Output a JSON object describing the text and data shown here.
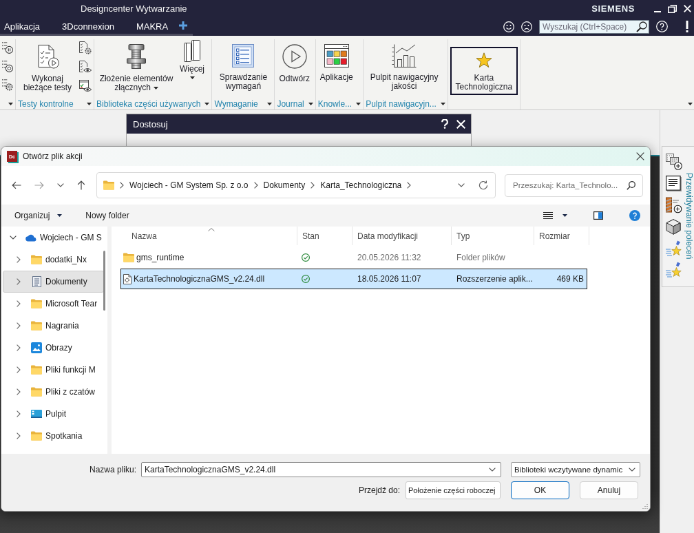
{
  "window": {
    "title": "Designcenter Wytwarzanie",
    "brand": "SIEMENS"
  },
  "menu": {
    "tabs": [
      {
        "label": "Aplikacja"
      },
      {
        "label": "3Dconnexion"
      },
      {
        "label": "MAKRA"
      }
    ],
    "search": {
      "placeholder": "Wyszukaj (Ctrl+Space)"
    }
  },
  "ribbon": {
    "groups": [
      {
        "launcher": true,
        "items": [
          {
            "kind": "small"
          },
          {
            "kind": "small"
          },
          {
            "kind": "small"
          }
        ]
      },
      {
        "label": "Testy kontrolne",
        "launcher": true,
        "items": [
          {
            "kind": "large",
            "label": "Wykonaj bieżące testy",
            "dropdown": false,
            "focused": false
          },
          {
            "kind": "small"
          },
          {
            "kind": "small"
          },
          {
            "kind": "small"
          }
        ]
      },
      {
        "label": "Biblioteka części używanych",
        "launcher": true,
        "items": [
          {
            "kind": "large",
            "label": "Złożenie elementów złącznych",
            "dropdown": true,
            "focused": false
          },
          {
            "kind": "menu",
            "label": "Więcej",
            "dropdown": true
          }
        ]
      },
      {
        "label": "Wymaganie",
        "launcher": true,
        "items": [
          {
            "kind": "large",
            "label": "Sprawdzanie wymagań",
            "dropdown": false,
            "focused": false
          }
        ]
      },
      {
        "label": "Journal",
        "launcher": true,
        "items": [
          {
            "kind": "large",
            "label": "Odtwórz",
            "dropdown": false,
            "focused": false
          }
        ]
      },
      {
        "label": "Knowle...",
        "launcher": true,
        "items": [
          {
            "kind": "large",
            "label": "Aplikacje",
            "dropdown": false,
            "focused": false
          }
        ]
      },
      {
        "label": "Pulpit nawigacyjn...",
        "launcher": true,
        "items": [
          {
            "kind": "large",
            "label": "Pulpit nawigacyjny jakości",
            "dropdown": false,
            "focused": false
          }
        ]
      },
      {
        "items": [
          {
            "kind": "large",
            "label": "Karta Technologiczna",
            "dropdown": false,
            "focused": true
          }
        ]
      }
    ]
  },
  "customize_dialog": {
    "title": "Dostosuj"
  },
  "open_dialog": {
    "title": "Otwórz plik akcji",
    "app_badge": "Dc",
    "path": [
      "Wojciech - GM System Sp. z o.o",
      "Dokumenty",
      "Karta_Technologiczna"
    ],
    "search": {
      "placeholder": "Przeszukaj: Karta_Technolo..."
    },
    "toolbar": {
      "organize": "Organizuj",
      "new_folder": "Nowy folder"
    },
    "nav_tree": [
      {
        "label": "Wojciech - GM S",
        "kind": "cloud",
        "expanded": true,
        "selected": false,
        "children": [
          {
            "label": "dodatki_Nx",
            "kind": "folder",
            "expanded": false,
            "selected": false
          },
          {
            "label": "Dokumenty",
            "kind": "documents",
            "expanded": false,
            "selected": true
          },
          {
            "label": "Microsoft Tear",
            "kind": "folder",
            "expanded": false,
            "selected": false
          },
          {
            "label": "Nagrania",
            "kind": "folder",
            "expanded": false,
            "selected": false
          },
          {
            "label": "Obrazy",
            "kind": "pictures",
            "expanded": false,
            "selected": false
          },
          {
            "label": "Pliki funkcji M",
            "kind": "folder",
            "expanded": false,
            "selected": false
          },
          {
            "label": "Pliki z czatów",
            "kind": "folder",
            "expanded": false,
            "selected": false
          },
          {
            "label": "Pulpit",
            "kind": "desktop",
            "expanded": false,
            "selected": false
          },
          {
            "label": "Spotkania",
            "kind": "folder",
            "expanded": false,
            "selected": false
          }
        ]
      }
    ],
    "columns": [
      {
        "label": "Nazwa",
        "sorted": true
      },
      {
        "label": "Stan",
        "sorted": false
      },
      {
        "label": "Data modyfikacji",
        "sorted": false
      },
      {
        "label": "Typ",
        "sorted": false
      },
      {
        "label": "Rozmiar",
        "sorted": false
      }
    ],
    "rows": [
      {
        "kind": "folder",
        "name": "gms_runtime",
        "synced": true,
        "modified": "20.05.2026 11:32",
        "type": "Folder plików",
        "selected": false
      },
      {
        "kind": "file",
        "name": "KartaTechnologicznaGMS_v2.24.dll",
        "synced": true,
        "modified": "18.05.2026 11:07",
        "type": "Rozszerzenie aplik...",
        "size": "469 KB",
        "selected": true
      }
    ],
    "file_name": {
      "label": "Nazwa pliku:",
      "value": "KartaTechnologicznaGMS_v2.24.dll"
    },
    "file_type": {
      "value": "Biblioteki wczytywane dynamic"
    },
    "go_to": {
      "label": "Przejdź do:",
      "value": "Położenie części roboczej"
    },
    "buttons": [
      {
        "label": "OK",
        "default": true
      },
      {
        "label": "Anuluj",
        "default": false
      }
    ]
  },
  "command_prediction": {
    "title": "Przewidywanie poleceń"
  }
}
